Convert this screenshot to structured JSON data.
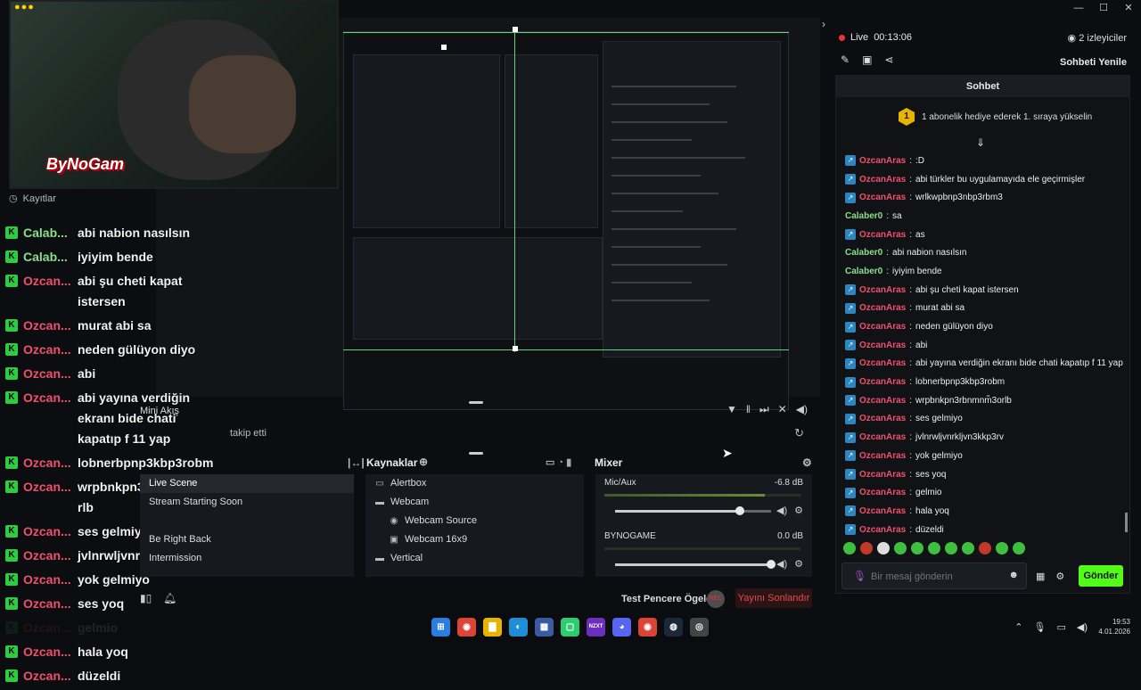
{
  "window": {
    "minimize": "—",
    "maximize": "☐",
    "close": "✕"
  },
  "webcam": {
    "logo_text": "ByNoGam",
    "dots": "●●●"
  },
  "recordings_label": "Kayıtlar",
  "overlay_chat": [
    {
      "user": "Calab...",
      "msg": "abi nabion nasılsın",
      "color": "green"
    },
    {
      "user": "Calab...",
      "msg": "iyiyim bende",
      "color": "green"
    },
    {
      "user": "Ozcan...",
      "msg": "abi şu cheti kapat istersen",
      "color": "red"
    },
    {
      "user": "Ozcan...",
      "msg": "murat abi sa",
      "color": "red"
    },
    {
      "user": "Ozcan...",
      "msg": "neden gülüyon diyo",
      "color": "red"
    },
    {
      "user": "Ozcan...",
      "msg": "abi",
      "color": "red"
    },
    {
      "user": "Ozcan...",
      "msg": "abi yayına verdiğin ekranı bide chati kapatıp f 11 yap",
      "color": "red"
    },
    {
      "user": "Ozcan...",
      "msg": "lobnerbpnp3kbp3robm",
      "color": "red"
    },
    {
      "user": "Ozcan...",
      "msg": "wrpbnkpn3rbnmnm̃3o rlb",
      "color": "red"
    },
    {
      "user": "Ozcan...",
      "msg": "ses gelmiyo",
      "color": "red"
    },
    {
      "user": "Ozcan...",
      "msg": "jvlnrwljvnrkljvn3kkp3rv",
      "color": "red"
    },
    {
      "user": "Ozcan...",
      "msg": "yok gelmiyo",
      "color": "red"
    },
    {
      "user": "Ozcan...",
      "msg": "ses yoq",
      "color": "red"
    },
    {
      "user": "Ozcan...",
      "msg": "gelmio",
      "color": "red"
    },
    {
      "user": "Ozcan...",
      "msg": "hala yoq",
      "color": "red"
    },
    {
      "user": "Ozcan...",
      "msg": "düzeldi",
      "color": "red"
    }
  ],
  "follow_text": "takip etti",
  "mini_akis": "Mini Akış",
  "panels": {
    "sources_title": "Kaynaklar",
    "mixer_title": "Mixer"
  },
  "scenes": [
    "Live Scene",
    "Stream Starting Soon",
    "",
    "Be Right Back",
    "Intermission"
  ],
  "sources": [
    {
      "label": "Alertbox",
      "indent": 0,
      "icon": "▭"
    },
    {
      "label": "Webcam",
      "indent": 0,
      "icon": "▬"
    },
    {
      "label": "Webcam Source",
      "indent": 1,
      "icon": "◉"
    },
    {
      "label": "Webcam 16x9",
      "indent": 1,
      "icon": "▣"
    },
    {
      "label": "Vertical",
      "indent": 0,
      "icon": "▬"
    }
  ],
  "mixer": [
    {
      "name": "Mic/Aux",
      "db": "-6.8 dB",
      "level": 0.82,
      "volume": 0.8
    },
    {
      "name": "BYNOGAME",
      "db": "0.0 dB",
      "level": 0.0,
      "volume": 1.0
    }
  ],
  "bottom_actions": {
    "test_label": "Test Pencere Ögeleri",
    "rec_label": "REC",
    "end_stream": "Yayını Sonlandır"
  },
  "sidebar": {
    "live_label": "Live",
    "live_time": "00:13:06",
    "viewers": "2 izleyiciler",
    "refresh_chat": "Sohbeti Yenile",
    "chat_title": "Sohbet",
    "gift_badge": "1",
    "gift_text": "1 abonelik hediye ederek 1. sıraya yükselin",
    "messages": [
      {
        "user": "OzcanAras",
        "msg": ":D",
        "badge": true
      },
      {
        "user": "OzcanAras",
        "msg": "abi türkler bu uygulamayıda ele geçirmişler",
        "badge": true
      },
      {
        "user": "OzcanAras",
        "msg": "wrlkwpbnp3nbp3rbm3",
        "badge": true
      },
      {
        "user": "Calaber0",
        "msg": "sa",
        "badge": false
      },
      {
        "user": "OzcanAras",
        "msg": "as",
        "badge": true
      },
      {
        "user": "Calaber0",
        "msg": "abi nabion nasılsın",
        "badge": false
      },
      {
        "user": "Calaber0",
        "msg": "iyiyim bende",
        "badge": false
      },
      {
        "user": "OzcanAras",
        "msg": "abi şu cheti kapat istersen",
        "badge": true
      },
      {
        "user": "OzcanAras",
        "msg": "murat abi sa",
        "badge": true
      },
      {
        "user": "OzcanAras",
        "msg": "neden gülüyon diyo",
        "badge": true
      },
      {
        "user": "OzcanAras",
        "msg": "abi",
        "badge": true
      },
      {
        "user": "OzcanAras",
        "msg": "abi yayına verdiğin ekranı bide chati kapatıp f 11 yap",
        "badge": true
      },
      {
        "user": "OzcanAras",
        "msg": "lobnerbpnp3kbp3robm",
        "badge": true
      },
      {
        "user": "OzcanAras",
        "msg": "wrpbnkpn3rbnmnm̃3orlb",
        "badge": true
      },
      {
        "user": "OzcanAras",
        "msg": "ses gelmiyo",
        "badge": true
      },
      {
        "user": "OzcanAras",
        "msg": "jvlnrwljvnrkljvn3kkp3rv",
        "badge": true
      },
      {
        "user": "OzcanAras",
        "msg": "yok gelmiyo",
        "badge": true
      },
      {
        "user": "OzcanAras",
        "msg": "ses yoq",
        "badge": true
      },
      {
        "user": "OzcanAras",
        "msg": "gelmio",
        "badge": true
      },
      {
        "user": "OzcanAras",
        "msg": "hala yoq",
        "badge": true
      },
      {
        "user": "OzcanAras",
        "msg": "düzeldi",
        "badge": true
      }
    ],
    "input_placeholder": "Bir mesaj gönderin",
    "send_label": "Gönder"
  },
  "taskbar": {
    "apps": [
      {
        "name": "windows-start-icon",
        "label": "⊞",
        "color": "#2a7de1"
      },
      {
        "name": "chrome-icon",
        "label": "◉",
        "color": "#db4437"
      },
      {
        "name": "file-explorer-icon",
        "label": "▇",
        "color": "#e8b400"
      },
      {
        "name": "edge-icon",
        "label": "◐",
        "color": "#1e8fd6"
      },
      {
        "name": "store-icon",
        "label": "▦",
        "color": "#3a5ba0"
      },
      {
        "name": "streaming-app-icon",
        "label": "▢",
        "color": "#2ecc71"
      },
      {
        "name": "nzxt-icon",
        "label": "NZXT",
        "color": "#6b2fbf"
      },
      {
        "name": "discord-icon",
        "label": "◕",
        "color": "#5865f2"
      },
      {
        "name": "chrome-alt-icon",
        "label": "◉",
        "color": "#db4437"
      },
      {
        "name": "steam-icon",
        "label": "◍",
        "color": "#1b2838"
      },
      {
        "name": "app-icon",
        "label": "◎",
        "color": "#444"
      }
    ],
    "time": "19:53",
    "date": "4.01.2026"
  },
  "colors": {
    "accent_green": "#53fc18",
    "chat_user_red": "#f0506e",
    "chat_user_green": "#8ae08a",
    "live_red": "#e33333"
  }
}
